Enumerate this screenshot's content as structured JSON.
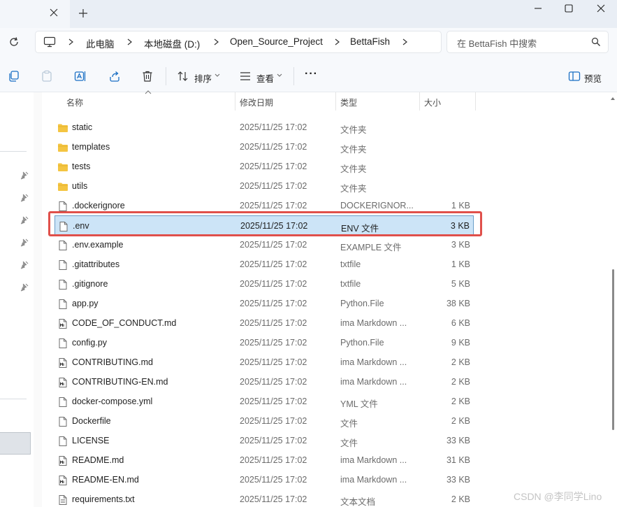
{
  "window": {
    "tab_close_glyph": "✕",
    "new_tab_glyph": "+"
  },
  "address_bar": {
    "breadcrumbs": [
      "此电脑",
      "本地磁盘 (D:)",
      "Open_Source_Project",
      "BettaFish"
    ],
    "search_placeholder": "在 BettaFish 中搜索"
  },
  "toolbar": {
    "sort_label": "排序",
    "view_label": "查看",
    "more_label": "···",
    "preview_label": "预览"
  },
  "columns": {
    "name": "名称",
    "date": "修改日期",
    "type": "类型",
    "size": "大小"
  },
  "files": [
    {
      "name": "static",
      "date": "2025/11/25 17:02",
      "type": "文件夹",
      "size": "",
      "icon": "folder-icon"
    },
    {
      "name": "templates",
      "date": "2025/11/25 17:02",
      "type": "文件夹",
      "size": "",
      "icon": "folder-icon"
    },
    {
      "name": "tests",
      "date": "2025/11/25 17:02",
      "type": "文件夹",
      "size": "",
      "icon": "folder-icon"
    },
    {
      "name": "utils",
      "date": "2025/11/25 17:02",
      "type": "文件夹",
      "size": "",
      "icon": "folder-icon"
    },
    {
      "name": ".dockerignore",
      "date": "2025/11/25 17:02",
      "type": "DOCKERIGNOR...",
      "size": "1 KB",
      "icon": "file-icon"
    },
    {
      "name": ".env",
      "date": "2025/11/25 17:02",
      "type": "ENV 文件",
      "size": "3 KB",
      "icon": "file-icon",
      "selected": true
    },
    {
      "name": ".env.example",
      "date": "2025/11/25 17:02",
      "type": "EXAMPLE 文件",
      "size": "3 KB",
      "icon": "file-icon"
    },
    {
      "name": ".gitattributes",
      "date": "2025/11/25 17:02",
      "type": "txtfile",
      "size": "1 KB",
      "icon": "file-icon"
    },
    {
      "name": ".gitignore",
      "date": "2025/11/25 17:02",
      "type": "txtfile",
      "size": "5 KB",
      "icon": "file-icon"
    },
    {
      "name": "app.py",
      "date": "2025/11/25 17:02",
      "type": "Python.File",
      "size": "38 KB",
      "icon": "file-icon"
    },
    {
      "name": "CODE_OF_CONDUCT.md",
      "date": "2025/11/25 17:02",
      "type": "ima Markdown ...",
      "size": "6 KB",
      "icon": "markdown-file-icon"
    },
    {
      "name": "config.py",
      "date": "2025/11/25 17:02",
      "type": "Python.File",
      "size": "9 KB",
      "icon": "file-icon"
    },
    {
      "name": "CONTRIBUTING.md",
      "date": "2025/11/25 17:02",
      "type": "ima Markdown ...",
      "size": "2 KB",
      "icon": "markdown-file-icon"
    },
    {
      "name": "CONTRIBUTING-EN.md",
      "date": "2025/11/25 17:02",
      "type": "ima Markdown ...",
      "size": "2 KB",
      "icon": "markdown-file-icon"
    },
    {
      "name": "docker-compose.yml",
      "date": "2025/11/25 17:02",
      "type": "YML 文件",
      "size": "2 KB",
      "icon": "file-icon"
    },
    {
      "name": "Dockerfile",
      "date": "2025/11/25 17:02",
      "type": "文件",
      "size": "2 KB",
      "icon": "file-icon"
    },
    {
      "name": "LICENSE",
      "date": "2025/11/25 17:02",
      "type": "文件",
      "size": "33 KB",
      "icon": "file-icon"
    },
    {
      "name": "README.md",
      "date": "2025/11/25 17:02",
      "type": "ima Markdown ...",
      "size": "31 KB",
      "icon": "markdown-file-icon"
    },
    {
      "name": "README-EN.md",
      "date": "2025/11/25 17:02",
      "type": "ima Markdown ...",
      "size": "33 KB",
      "icon": "markdown-file-icon"
    },
    {
      "name": "requirements.txt",
      "date": "2025/11/25 17:02",
      "type": "文本文档",
      "size": "2 KB",
      "icon": "text-file-icon"
    }
  ],
  "watermark": "CSDN @李同学Lino",
  "colors": {
    "selection_bg": "#cce4f7",
    "selection_border": "#6a9ec8",
    "highlight_box": "#e0504b",
    "folder": "#f4c542"
  }
}
